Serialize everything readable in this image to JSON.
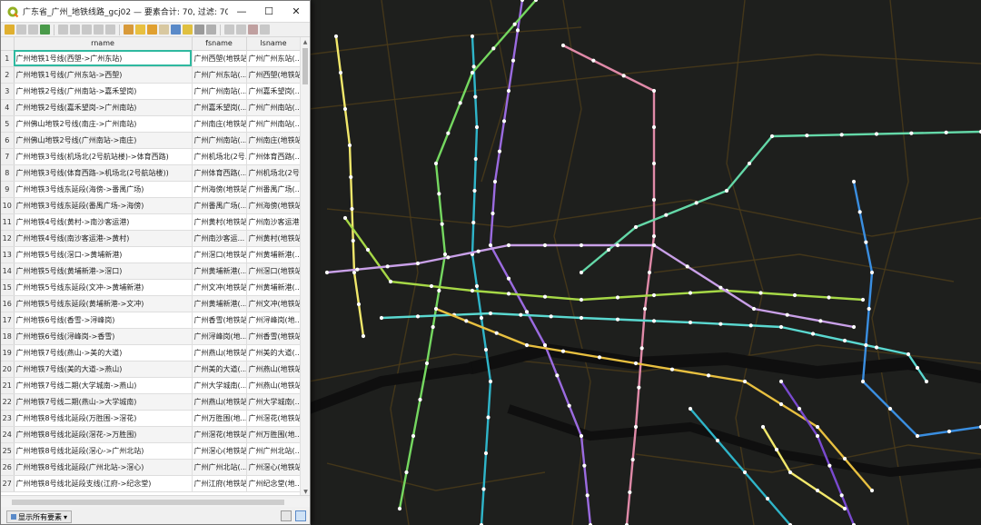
{
  "window": {
    "title": "广东省_广州_地铁线路_gcj02 — 要素合计: 70, 过滤: 70, 选择: 0",
    "minimize_glyph": "—",
    "maximize_glyph": "☐",
    "close_glyph": "✕"
  },
  "table": {
    "headers": [
      "rname",
      "fsname",
      "lsname"
    ],
    "rows": [
      {
        "n": "1",
        "rname": "广州地铁1号线(西塱->广州东站)",
        "fsname": "广州西塱(地铁站)",
        "lsname": "广州广州东站(..."
      },
      {
        "n": "2",
        "rname": "广州地铁1号线(广州东站->西塱)",
        "fsname": "广州广州东站(...",
        "lsname": "广州西塱(地铁站)"
      },
      {
        "n": "3",
        "rname": "广州地铁2号线(广州南站->嘉禾望岗)",
        "fsname": "广州广州南站(...",
        "lsname": "广州嘉禾望岗(..."
      },
      {
        "n": "4",
        "rname": "广州地铁2号线(嘉禾望岗->广州南站)",
        "fsname": "广州嘉禾望岗(...",
        "lsname": "广州广州南站(..."
      },
      {
        "n": "5",
        "rname": "广州佛山地铁2号线(南庄->广州南站)",
        "fsname": "广州南庄(地铁站)",
        "lsname": "广州广州南站(..."
      },
      {
        "n": "6",
        "rname": "广州佛山地铁2号线(广州南站->南庄)",
        "fsname": "广州广州南站(...",
        "lsname": "广州南庄(地铁站)"
      },
      {
        "n": "7",
        "rname": "广州地铁3号线(机场北(2号航站楼)->体育西路)",
        "fsname": "广州机场北(2号...",
        "lsname": "广州体育西路(..."
      },
      {
        "n": "8",
        "rname": "广州地铁3号线(体育西路->机场北(2号航站楼))",
        "fsname": "广州体育西路(...",
        "lsname": "广州机场北(2号..."
      },
      {
        "n": "9",
        "rname": "广州地铁3号线东延段(海傍->番禺广场)",
        "fsname": "广州海傍(地铁站)",
        "lsname": "广州番禺广场(..."
      },
      {
        "n": "10",
        "rname": "广州地铁3号线东延段(番禺广场->海傍)",
        "fsname": "广州番禺广场(...",
        "lsname": "广州海傍(地铁站)"
      },
      {
        "n": "11",
        "rname": "广州地铁4号线(黄村->南沙客运港)",
        "fsname": "广州黄村(地铁站)",
        "lsname": "广州南沙客运港..."
      },
      {
        "n": "12",
        "rname": "广州地铁4号线(南沙客运港->黄村)",
        "fsname": "广州南沙客运...",
        "lsname": "广州黄村(地铁站)"
      },
      {
        "n": "13",
        "rname": "广州地铁5号线(滘口->黄埔新港)",
        "fsname": "广州滘口(地铁站)",
        "lsname": "广州黄埔新港(..."
      },
      {
        "n": "14",
        "rname": "广州地铁5号线(黄埔新港->滘口)",
        "fsname": "广州黄埔新港(...",
        "lsname": "广州滘口(地铁站)"
      },
      {
        "n": "15",
        "rname": "广州地铁5号线东延段(文冲->黄埔新港)",
        "fsname": "广州文冲(地铁站)",
        "lsname": "广州黄埔新港(..."
      },
      {
        "n": "16",
        "rname": "广州地铁5号线东延段(黄埔新港->文冲)",
        "fsname": "广州黄埔新港(...",
        "lsname": "广州文冲(地铁站)"
      },
      {
        "n": "17",
        "rname": "广州地铁6号线(香雪->浔峰岗)",
        "fsname": "广州香雪(地铁站)",
        "lsname": "广州浔峰岗(地..."
      },
      {
        "n": "18",
        "rname": "广州地铁6号线(浔峰岗->香雪)",
        "fsname": "广州浔峰岗(地...",
        "lsname": "广州香雪(地铁站)"
      },
      {
        "n": "19",
        "rname": "广州地铁7号线(燕山->美的大道)",
        "fsname": "广州燕山(地铁站)",
        "lsname": "广州美的大道(..."
      },
      {
        "n": "20",
        "rname": "广州地铁7号线(美的大道->燕山)",
        "fsname": "广州美的大道(...",
        "lsname": "广州燕山(地铁站)"
      },
      {
        "n": "21",
        "rname": "广州地铁7号线二期(大学城南->燕山)",
        "fsname": "广州大学城南(...",
        "lsname": "广州燕山(地铁站)"
      },
      {
        "n": "22",
        "rname": "广州地铁7号线二期(燕山->大学城南)",
        "fsname": "广州燕山(地铁站)",
        "lsname": "广州大学城南(..."
      },
      {
        "n": "23",
        "rname": "广州地铁8号线北延段(万胜围->滘花)",
        "fsname": "广州万胜围(地...",
        "lsname": "广州滘花(地铁站)"
      },
      {
        "n": "24",
        "rname": "广州地铁8号线北延段(滘花->万胜围)",
        "fsname": "广州滘花(地铁站)",
        "lsname": "广州万胜围(地..."
      },
      {
        "n": "25",
        "rname": "广州地铁8号线北延段(滘心->广州北站)",
        "fsname": "广州滘心(地铁站)",
        "lsname": "广州广州北站(..."
      },
      {
        "n": "26",
        "rname": "广州地铁8号线北延段(广州北站->滘心)",
        "fsname": "广州广州北站(...",
        "lsname": "广州滘心(地铁站)"
      },
      {
        "n": "27",
        "rname": "广州地铁8号线北延段支线(江府->纪念堂)",
        "fsname": "广州江府(地铁站)",
        "lsname": "广州纪念堂(地..."
      }
    ]
  },
  "statusbar": {
    "filter_label": "显示所有要素"
  },
  "colors": {
    "map_background": "#1e1f1d",
    "road": "#4a3b1a",
    "river": "#0f0f0f",
    "selection": "#2fb9a0",
    "station": "#ffffff"
  },
  "map": {
    "lines": [
      {
        "name": "line-1",
        "color": "#f2e86b"
      },
      {
        "name": "line-2",
        "color": "#2fb5c9"
      },
      {
        "name": "line-3",
        "color": "#9b6be0"
      },
      {
        "name": "line-4",
        "color": "#75d860"
      },
      {
        "name": "line-5",
        "color": "#e08aa8"
      },
      {
        "name": "line-6",
        "color": "#64d8a8"
      },
      {
        "name": "line-7",
        "color": "#a6d846"
      },
      {
        "name": "line-8",
        "color": "#c9a0e8"
      },
      {
        "name": "line-9",
        "color": "#5ad8d0"
      },
      {
        "name": "line-10",
        "color": "#e8c040"
      },
      {
        "name": "line-11",
        "color": "#3a8ee0"
      },
      {
        "name": "line-12",
        "color": "#7a4ad0"
      }
    ]
  }
}
